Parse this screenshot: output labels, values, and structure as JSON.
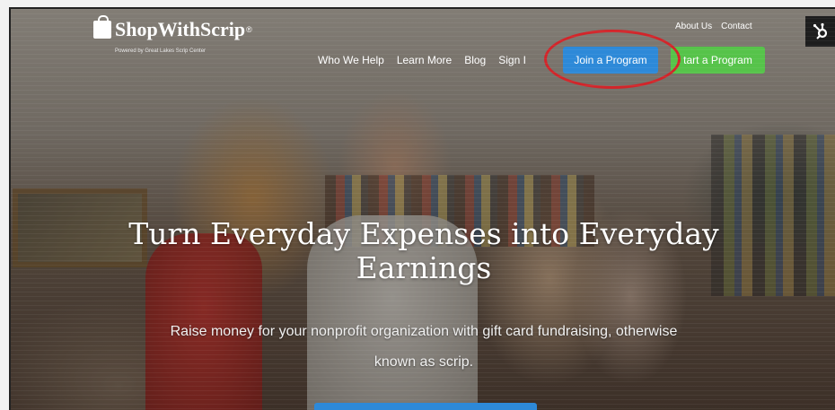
{
  "brand": {
    "name": "ShopWithScrip",
    "trademark": "®",
    "tagline": "Powered by Great Lakes Scrip Center"
  },
  "utility_links": [
    "About Us",
    "Contact"
  ],
  "nav": {
    "links": [
      "Who We Help",
      "Learn More",
      "Blog",
      "Sign I"
    ],
    "join_button": "Join a Program",
    "start_button": "tart a Program"
  },
  "hero": {
    "title_line1": "Turn Everyday Expenses into Everyday",
    "title_line2": "Earnings",
    "subtitle_line1": "Raise money for your nonprofit organization with gift card fundraising, otherwise",
    "subtitle_line2": "known as scrip."
  },
  "icons": {
    "hubspot": "hubspot-sprocket-icon",
    "logo": "shopping-bag-icon"
  },
  "colors": {
    "join_button": "#2d89d8",
    "start_button": "#56c34a",
    "annotation": "#d2252a"
  }
}
